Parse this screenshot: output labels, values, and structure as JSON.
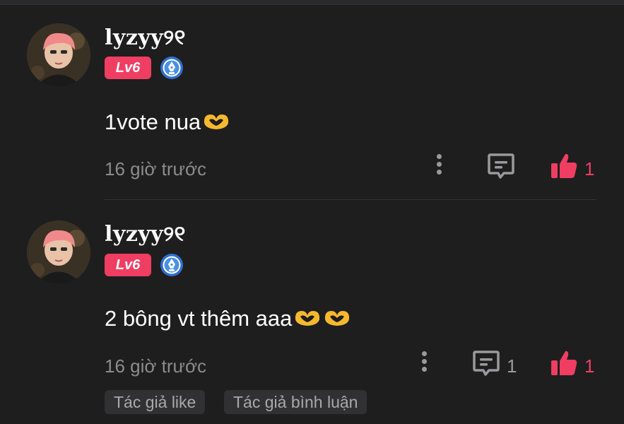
{
  "comments": [
    {
      "username": "lyzyy୨୧",
      "level": "Lv6",
      "text": "1vote nua",
      "heart_emoji_count": 1,
      "time": "16 giờ trước",
      "reply_count": "",
      "like_count": "1"
    },
    {
      "username": "lyzyy୨୧",
      "level": "Lv6",
      "text": "2 bông vt thêm aaa",
      "heart_emoji_count": 2,
      "time": "16 giờ trước",
      "reply_count": "1",
      "like_count": "1"
    }
  ],
  "tags": [
    "Tác giả like",
    "Tác giả bình luận"
  ],
  "icons": {
    "more": "more-vertical-icon",
    "reply": "comment-bubble-icon",
    "like": "thumbs-up-icon",
    "badge": "pen-badge-icon",
    "emoji": "heart-hands-emoji"
  },
  "colors": {
    "background": "#1e1e1f",
    "accent": "#ef3e62",
    "muted_text": "#8c8c8e",
    "badge_blue": "#4a90e2"
  }
}
